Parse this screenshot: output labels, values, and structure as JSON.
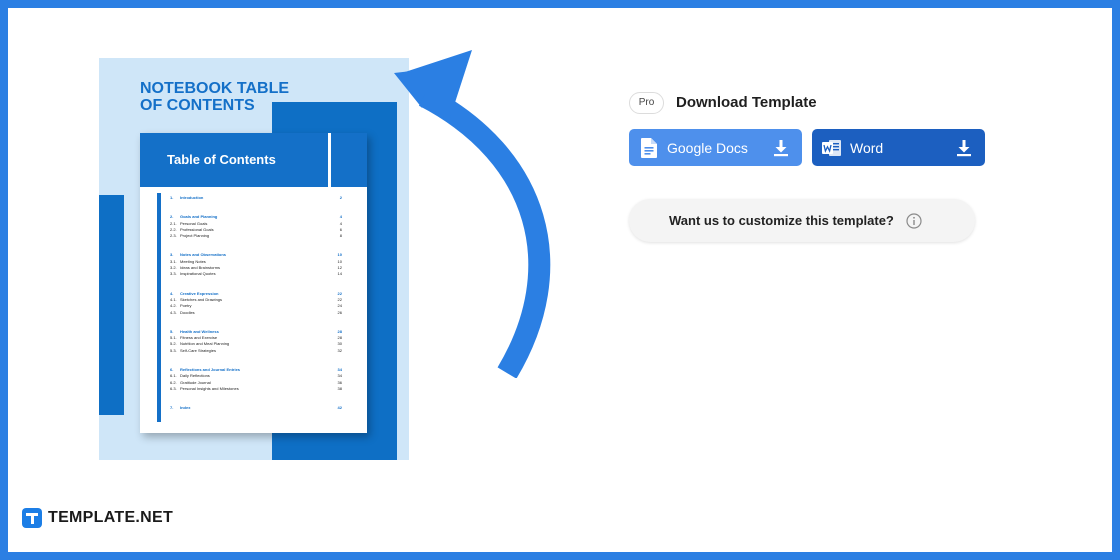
{
  "preview": {
    "title": "NOTEBOOK TABLE OF CONTENTS",
    "sheet_heading": "Table of Contents",
    "sections": [
      {
        "num": "1.",
        "title": "Introduction",
        "page": "2",
        "items": []
      },
      {
        "num": "2.",
        "title": "Goals and Planning",
        "page": "4",
        "items": [
          {
            "num": "2.1.",
            "title": "Personal Goals",
            "page": "4"
          },
          {
            "num": "2.2.",
            "title": "Professional Goals",
            "page": "6"
          },
          {
            "num": "2.3.",
            "title": "Project Planning",
            "page": "8"
          }
        ]
      },
      {
        "num": "3.",
        "title": "Notes and Observations",
        "page": "10",
        "items": [
          {
            "num": "3.1.",
            "title": "Meeting Notes",
            "page": "10"
          },
          {
            "num": "3.2.",
            "title": "Ideas and Brainstorms",
            "page": "12"
          },
          {
            "num": "3.3.",
            "title": "Inspirational Quotes",
            "page": "14"
          }
        ]
      },
      {
        "num": "4.",
        "title": "Creative Expression",
        "page": "22",
        "items": [
          {
            "num": "4.1.",
            "title": "Sketches and Drawings",
            "page": "22"
          },
          {
            "num": "4.2.",
            "title": "Poetry",
            "page": "24"
          },
          {
            "num": "4.3.",
            "title": "Doodles",
            "page": "26"
          }
        ]
      },
      {
        "num": "5.",
        "title": "Health and Wellness",
        "page": "28",
        "items": [
          {
            "num": "5.1.",
            "title": "Fitness and Exercise",
            "page": "28"
          },
          {
            "num": "5.2.",
            "title": "Nutrition and Meal Planning",
            "page": "30"
          },
          {
            "num": "5.3.",
            "title": "Self-Care Strategies",
            "page": "32"
          }
        ]
      },
      {
        "num": "6.",
        "title": "Reflections and Journal Entries",
        "page": "34",
        "items": [
          {
            "num": "6.1.",
            "title": "Daily Reflections",
            "page": "34"
          },
          {
            "num": "6.2.",
            "title": "Gratitude Journal",
            "page": "36"
          },
          {
            "num": "6.3.",
            "title": "Personal Insights and Milestones",
            "page": "38"
          }
        ]
      },
      {
        "num": "7.",
        "title": "Index",
        "page": "42",
        "items": []
      }
    ]
  },
  "download": {
    "badge": "Pro",
    "title": "Download Template",
    "gdocs_label": "Google Docs",
    "word_label": "Word"
  },
  "customize": {
    "label": "Want us to customize this template?"
  },
  "logo": {
    "text": "TEMPLATE.NET"
  },
  "colors": {
    "frame": "#2b7fe3",
    "accent_blue": "#1470c8",
    "gdocs_button": "#4e90ec",
    "word_button": "#1c5fc0"
  },
  "icons": {
    "gdocs": "google-docs-icon",
    "word": "word-icon",
    "download": "download-icon",
    "info": "info-icon",
    "arrow": "curved-arrow-icon"
  }
}
